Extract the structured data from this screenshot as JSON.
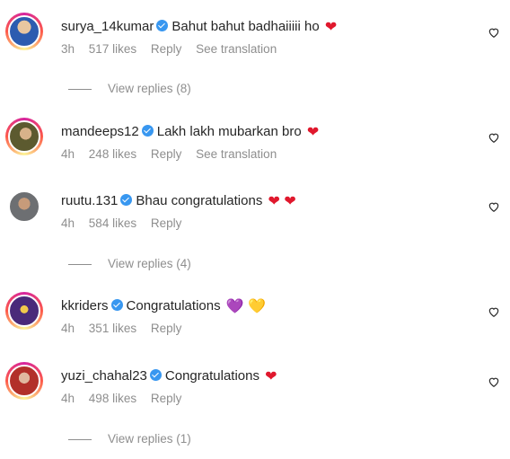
{
  "comments": [
    {
      "username": "surya_14kumar",
      "text": "Bahut bahut badhaiiiii ho",
      "emoji": "❤",
      "time": "3h",
      "likes": "517 likes",
      "reply": "Reply",
      "translation": "See translation",
      "view_replies": "View replies (8)",
      "avatar_color": "#3a6ec4"
    },
    {
      "username": "mandeeps12",
      "text": "Lakh lakh mubarkan bro",
      "emoji": "❤",
      "time": "4h",
      "likes": "248 likes",
      "reply": "Reply",
      "translation": "See translation",
      "view_replies": "",
      "avatar_color": "#6b6a3a"
    },
    {
      "username": "ruutu.131",
      "text": "Bhau congratulations",
      "emoji": "❤ ❤",
      "time": "4h",
      "likes": "584 likes",
      "reply": "Reply",
      "translation": "",
      "view_replies": "View replies (4)",
      "avatar_color": "#7a6450"
    },
    {
      "username": "kkriders",
      "text": "Congratulations",
      "emoji": "💜 💛",
      "time": "4h",
      "likes": "351 likes",
      "reply": "Reply",
      "translation": "",
      "view_replies": "",
      "avatar_color": "#5a2f8a"
    },
    {
      "username": "yuzi_chahal23",
      "text": "Congratulations",
      "emoji": "❤",
      "time": "4h",
      "likes": "498 likes",
      "reply": "Reply",
      "translation": "",
      "view_replies": "View replies (1)",
      "avatar_color": "#b23a2a"
    }
  ],
  "colors": {
    "heart_red": "#e0182d",
    "verified_blue": "#3897f0",
    "muted": "#8e8e8e"
  },
  "icons": {
    "like": "heart-outline-icon",
    "verified": "verified-badge-icon"
  }
}
